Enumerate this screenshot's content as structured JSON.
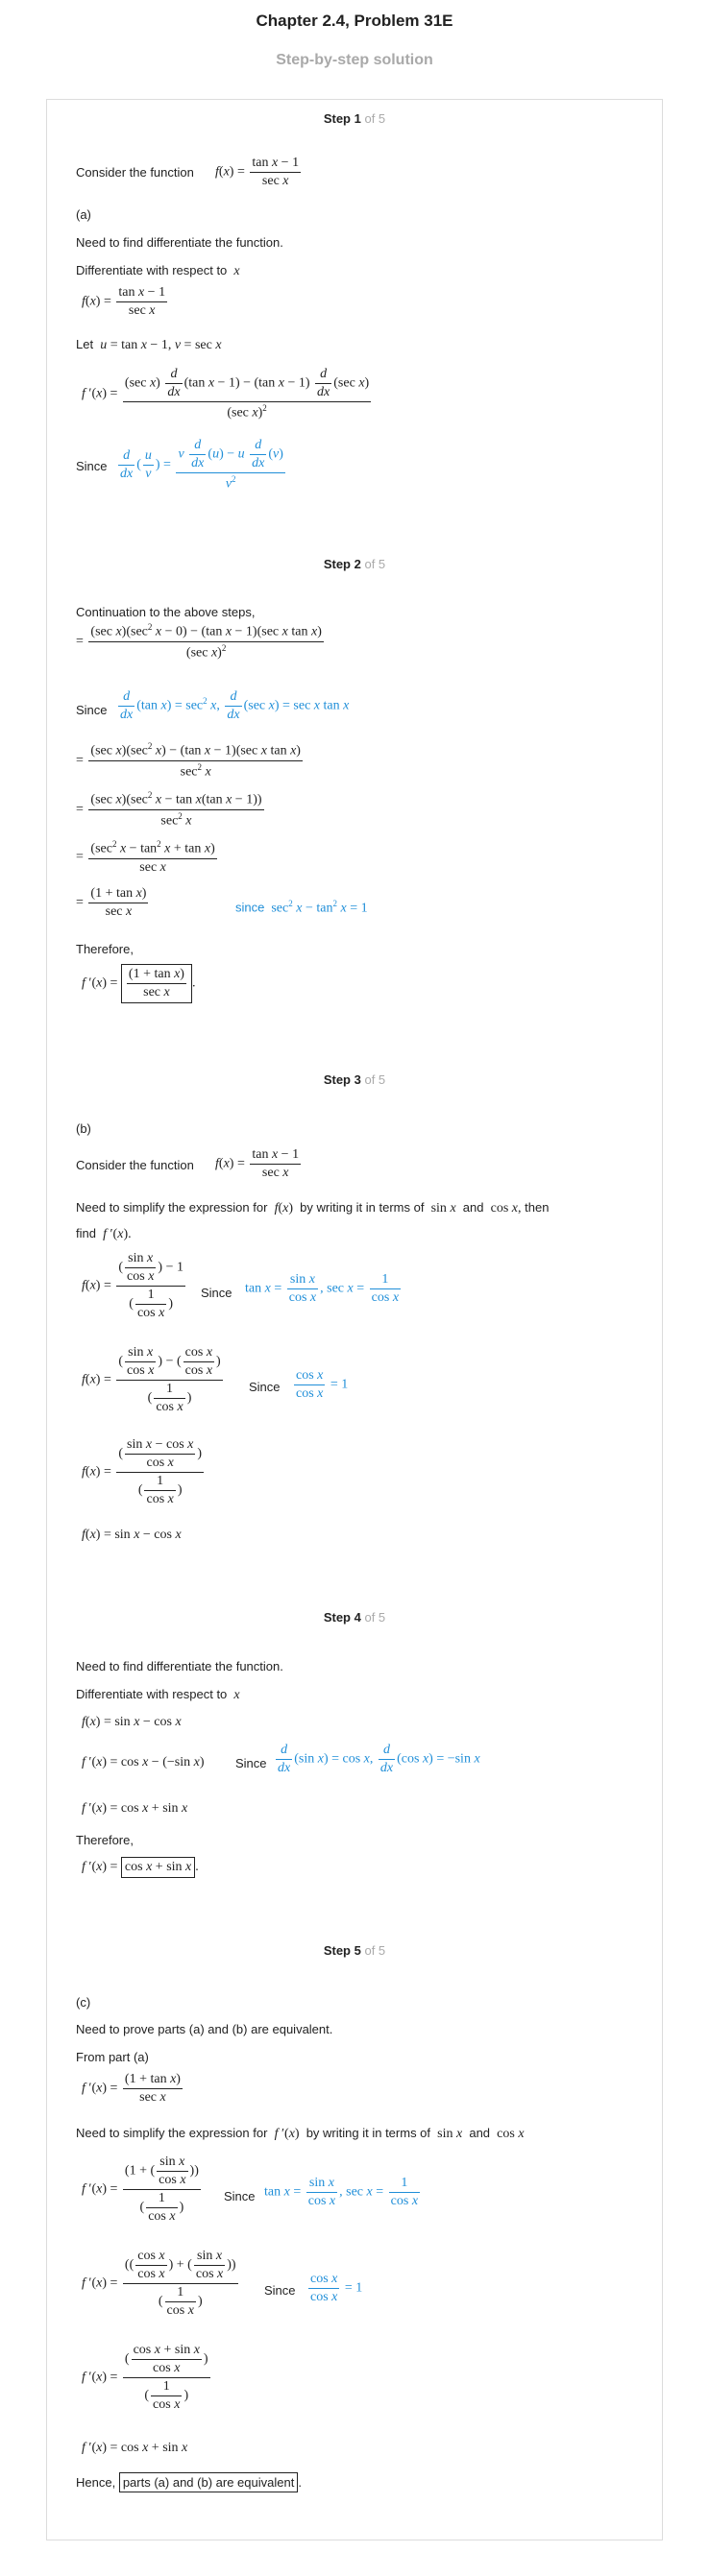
{
  "header": {
    "title": "Chapter 2.4, Problem 31E",
    "subtitle": "Step-by-step solution"
  },
  "steps": [
    {
      "label": "Step 1",
      "of": "of 5"
    },
    {
      "label": "Step 2",
      "of": "of 5"
    },
    {
      "label": "Step 3",
      "of": "of 5"
    },
    {
      "label": "Step 4",
      "of": "of 5"
    },
    {
      "label": "Step 5",
      "of": "of 5"
    }
  ],
  "text": {
    "s1_consider": "Consider the function",
    "s1_a": "(a)",
    "s1_need": "Need to find differentiate the function.",
    "s1_diff": "Differentiate with respect to",
    "s1_let": "Let",
    "s1_since": "Since",
    "s2_cont": "Continuation to the above steps,",
    "s2_since": "Since",
    "s2_since2": "since",
    "s2_therefore": "Therefore,",
    "s3_b": "(b)",
    "s3_consider": "Consider the function",
    "s3_need1": "Need to simplify the expression for",
    "s3_need2": "by writing it in terms of",
    "s3_and": "and",
    "s3_then": "then",
    "s3_find": "find",
    "s3_since": "Since",
    "s4_need": "Need to find differentiate the function.",
    "s4_diff": "Differentiate with respect to",
    "s4_since": "Since",
    "s4_therefore": "Therefore,",
    "s5_c": "(c)",
    "s5_need": "Need to prove parts (a) and (b) are equivalent.",
    "s5_from": "From part (a)",
    "s5_simplify1": "Need to simplify the expression for",
    "s5_simplify2": "by writing it in terms of",
    "s5_and": "and",
    "s5_since": "Since",
    "s5_hence": "Hence,",
    "s5_final": "parts (a) and (b) are equivalent"
  },
  "colors": {
    "accent": "#1f8ed8",
    "muted": "#a9a9a9",
    "border": "#dcdcdc"
  }
}
